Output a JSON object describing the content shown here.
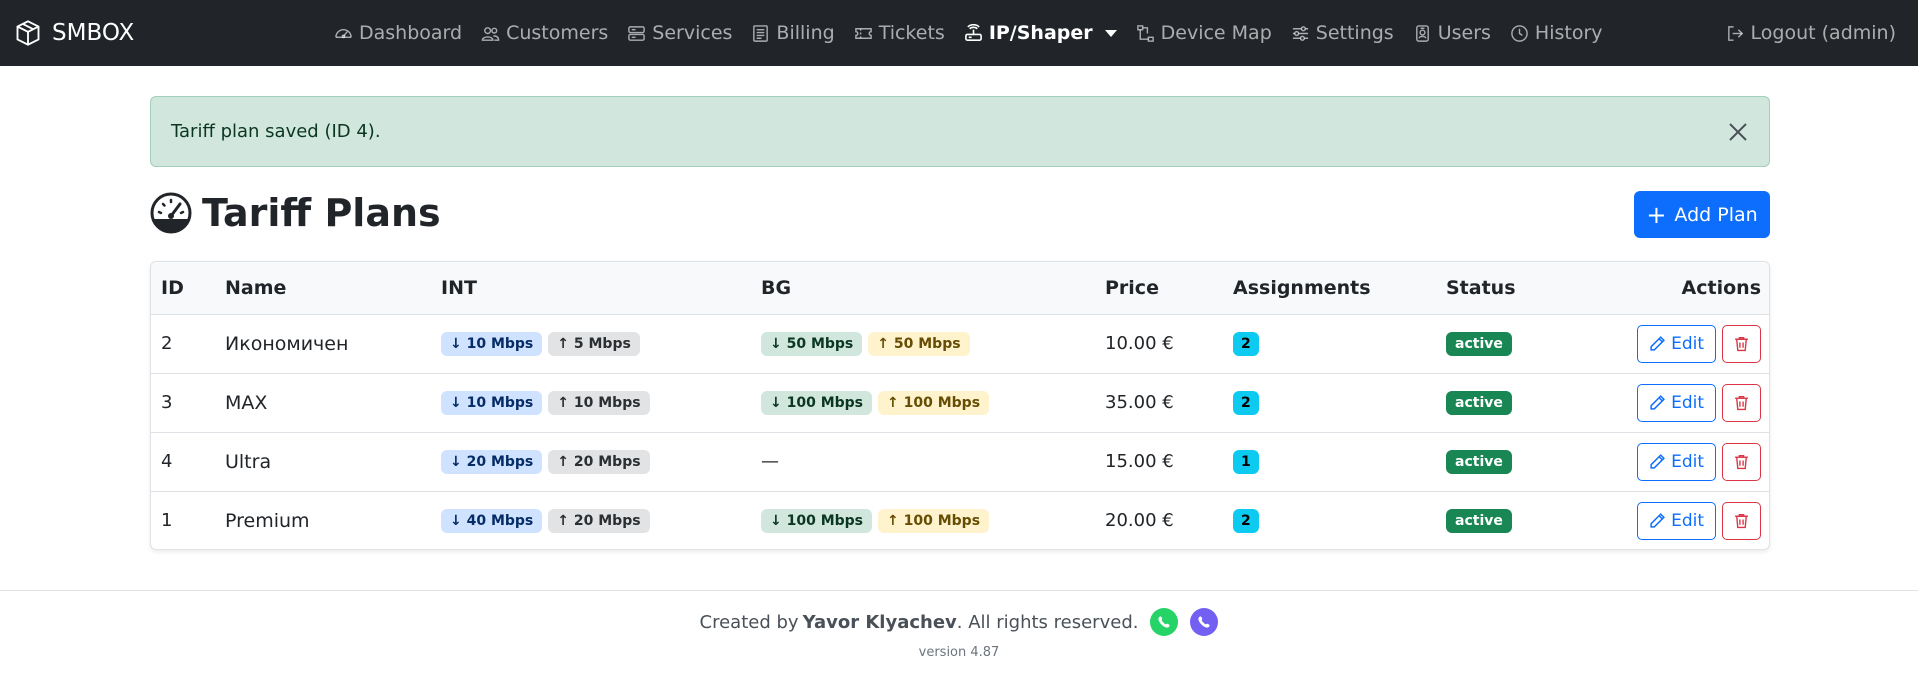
{
  "brand": {
    "name": "SMBOX",
    "icon": "box-icon"
  },
  "nav": {
    "items": [
      {
        "label": "Dashboard",
        "icon": "speedometer-icon"
      },
      {
        "label": "Customers",
        "icon": "people-icon"
      },
      {
        "label": "Services",
        "icon": "server-icon"
      },
      {
        "label": "Billing",
        "icon": "receipt-icon"
      },
      {
        "label": "Tickets",
        "icon": "ticket-icon"
      },
      {
        "label": "IP/Shaper",
        "icon": "router-icon",
        "active": true
      },
      {
        "label": "Device Map",
        "icon": "diagram-icon"
      },
      {
        "label": "Settings",
        "icon": "sliders-icon"
      },
      {
        "label": "Users",
        "icon": "person-badge-icon"
      },
      {
        "label": "History",
        "icon": "clock-icon"
      }
    ],
    "logout_label": "Logout (admin)"
  },
  "alert": {
    "message": "Tariff plan saved (ID 4)."
  },
  "page": {
    "title": "Tariff Plans",
    "add_label": "Add Plan"
  },
  "table": {
    "columns": [
      "ID",
      "Name",
      "INT",
      "BG",
      "Price",
      "Assignments",
      "Status",
      "Actions"
    ],
    "rows": [
      {
        "id": "2",
        "name": "Икономичен",
        "int_down": "↓ 10 Mbps",
        "int_up": "↑ 5 Mbps",
        "bg_down": "↓ 50 Mbps",
        "bg_up": "↑ 50 Mbps",
        "bg_none": "",
        "price": "10.00 €",
        "assignments": "2",
        "status": "active"
      },
      {
        "id": "3",
        "name": "MAX",
        "int_down": "↓ 10 Mbps",
        "int_up": "↑ 10 Mbps",
        "bg_down": "↓ 100 Mbps",
        "bg_up": "↑ 100 Mbps",
        "bg_none": "",
        "price": "35.00 €",
        "assignments": "2",
        "status": "active"
      },
      {
        "id": "4",
        "name": "Ultra",
        "int_down": "↓ 20 Mbps",
        "int_up": "↑ 20 Mbps",
        "bg_down": "",
        "bg_up": "",
        "bg_none": "—",
        "price": "15.00 €",
        "assignments": "1",
        "status": "active"
      },
      {
        "id": "1",
        "name": "Premium",
        "int_down": "↓ 40 Mbps",
        "int_up": "↑ 20 Mbps",
        "bg_down": "↓ 100 Mbps",
        "bg_up": "↑ 100 Mbps",
        "bg_none": "",
        "price": "20.00 €",
        "assignments": "2",
        "status": "active"
      }
    ],
    "edit_label": "Edit"
  },
  "footer": {
    "created_by": "Created by",
    "author": "Yavor Klyachev",
    "rights": ". All rights reserved.",
    "version": "version 4.87"
  },
  "colors": {
    "navbar": "#212529",
    "primary": "#0d6efd",
    "success": "#198754",
    "info": "#0dcaf0",
    "danger": "#dc3545",
    "alert_bg": "#d1e7dd"
  }
}
